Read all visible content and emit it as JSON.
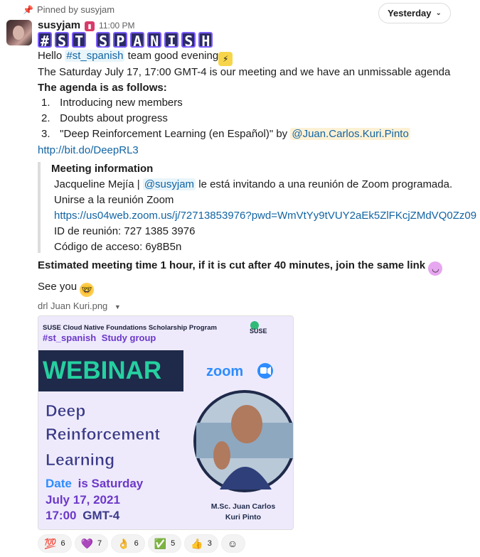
{
  "pinned": {
    "label": "Pinned by susyjam"
  },
  "date_pill": {
    "label": "Yesterday"
  },
  "message": {
    "author": "susyjam",
    "time": "11:00 PM",
    "banner_letters": [
      "#",
      "S",
      "T",
      "",
      "S",
      "P",
      "A",
      "N",
      "I",
      "S",
      "H"
    ],
    "hello": "Hello",
    "channel_tag": "#st_spanish",
    "hello_rest": "team good evening",
    "meeting_line": "The Saturday July 17, 17:00 GMT-4 is our meeting and we have an unmissable agenda",
    "agenda_heading": "The agenda is as follows:",
    "agenda": [
      {
        "num": "1.",
        "text": "Introducing new members"
      },
      {
        "num": "2.",
        "text": "Doubts about progress"
      },
      {
        "num": "3.",
        "text": "\"Deep Reinforcement Learning (en Español)\" by"
      }
    ],
    "agenda_mention": "@Juan.Carlos.Kuri.Pinto",
    "deeprl_link": "http://bit.do/DeepRL3",
    "quote": {
      "title": "Meeting information",
      "host_prefix": "Jacqueline Mejía |",
      "host_mention": "@susyjam",
      "host_suffix": "le está invitando a una reunión de Zoom programada.",
      "join_label": "Unirse a la reunión Zoom",
      "zoom_link": "https://us04web.zoom.us/j/72713853976?pwd=WmVtYy9tVUY2aEk5ZlFKcjZMdVQ0Zz09",
      "meeting_id": "ID de reunión: 727 1385 3976",
      "passcode": "Código de acceso: 6y8B5n"
    },
    "estimated": "Estimated meeting time 1 hour, if it is cut after 40 minutes, join the same link",
    "see_you": "See you"
  },
  "attachment": {
    "filename": "drl Juan Kuri.png",
    "program": "SUSE Cloud Native Foundations Scholarship Program",
    "group_tag": "#st_spanish",
    "group_rest": "Study group",
    "suse": "SUSE",
    "webinar": "WEBINAR",
    "zoom": "zoom",
    "title_lines": [
      "Deep",
      "Reinforcement",
      "Learning"
    ],
    "date_word": "Date",
    "date_rest": "is Saturday",
    "date_line": "July 17, 2021",
    "time_bold": "17:00",
    "time_rest": "GMT-4",
    "speaker_line1": "M.Sc. Juan Carlos",
    "speaker_line2": "Kuri Pinto"
  },
  "reactions": [
    {
      "emoji": "💯",
      "count": "6"
    },
    {
      "emoji": "💜",
      "count": "7"
    },
    {
      "emoji": "👌",
      "count": "6"
    },
    {
      "emoji": "✅",
      "count": "5"
    },
    {
      "emoji": "👍",
      "count": "3"
    }
  ],
  "colors": {
    "link": "#1264a3",
    "mention_bg": "#fdf1d5",
    "webinar_bg": "#1f2a4a",
    "webinar_text": "#25d0a0",
    "poster_purple": "#6c38c9",
    "zoom_blue": "#2d8cff"
  }
}
